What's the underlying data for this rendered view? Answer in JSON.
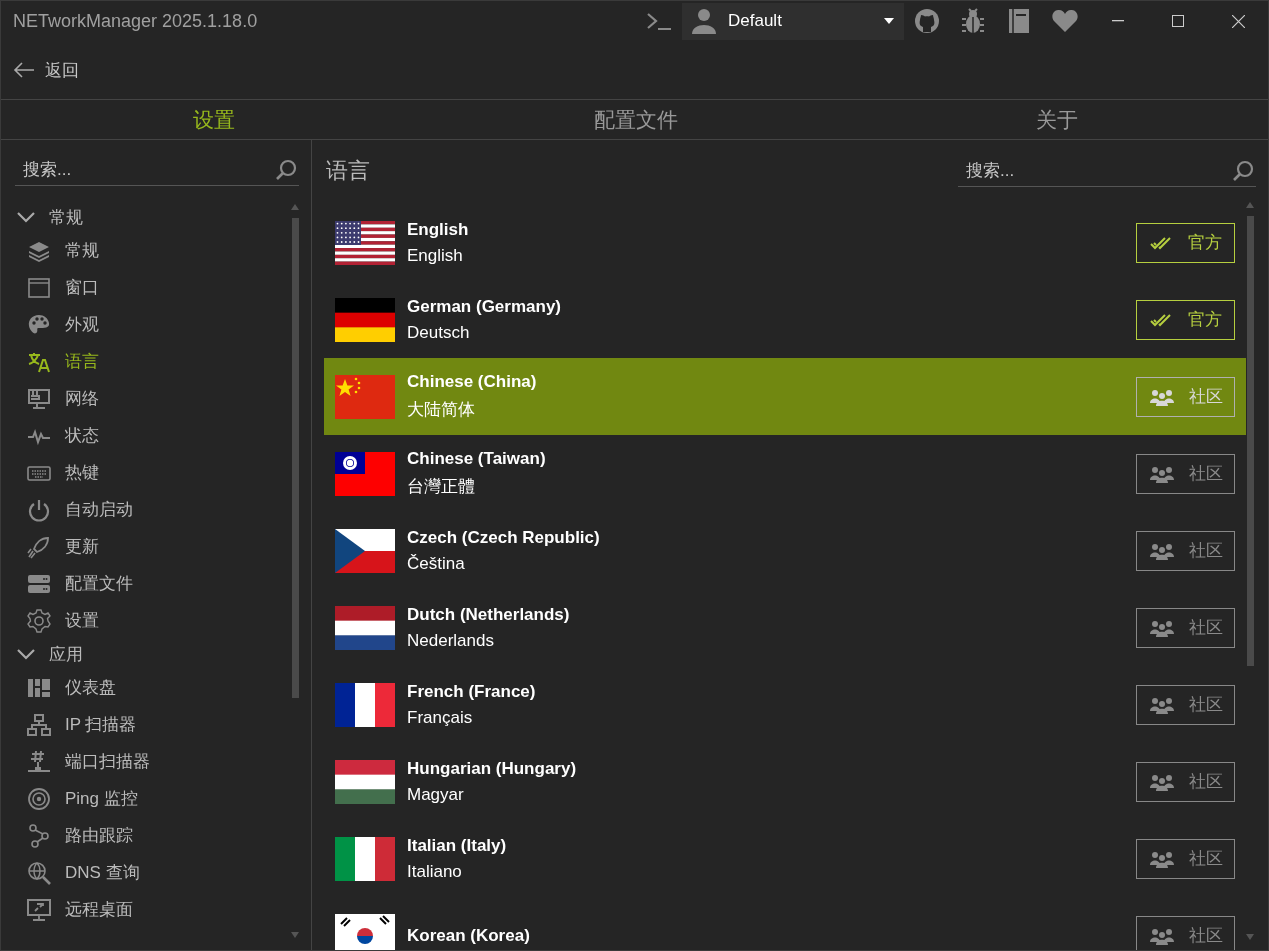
{
  "window": {
    "title": "NETworkManager 2025.1.18.0"
  },
  "profile": {
    "value": "Default"
  },
  "back": {
    "label": "返回"
  },
  "tabs": [
    {
      "label": "设置",
      "selected": true
    },
    {
      "label": "配置文件",
      "selected": false
    },
    {
      "label": "关于",
      "selected": false
    }
  ],
  "sidebar": {
    "search": {
      "placeholder": "搜索..."
    },
    "groups": [
      {
        "label": "常规",
        "expanded": true,
        "children": [
          {
            "label": "常规",
            "selected": false
          },
          {
            "label": "窗口",
            "selected": false
          },
          {
            "label": "外观",
            "selected": false
          },
          {
            "label": "语言",
            "selected": true
          },
          {
            "label": "网络",
            "selected": false
          },
          {
            "label": "状态",
            "selected": false
          },
          {
            "label": "热键",
            "selected": false
          },
          {
            "label": "自动启动",
            "selected": false
          },
          {
            "label": "更新",
            "selected": false
          },
          {
            "label": "配置文件",
            "selected": false
          },
          {
            "label": "设置",
            "selected": false
          }
        ]
      },
      {
        "label": "应用",
        "expanded": true,
        "children": [
          {
            "label": "仪表盘",
            "selected": false
          },
          {
            "label": "IP 扫描器",
            "selected": false
          },
          {
            "label": "端口扫描器",
            "selected": false
          },
          {
            "label": "Ping 监控",
            "selected": false
          },
          {
            "label": "路由跟踪",
            "selected": false
          },
          {
            "label": "DNS 查询",
            "selected": false
          },
          {
            "label": "远程桌面",
            "selected": false
          }
        ]
      }
    ]
  },
  "content": {
    "heading": "语言",
    "search": {
      "placeholder": "搜索..."
    },
    "languages": [
      {
        "kind": "us",
        "name": "English",
        "native": "English",
        "selected": false,
        "badge": {
          "kind": "official",
          "label": "官方"
        }
      },
      {
        "kind": "de",
        "name": "German (Germany)",
        "native": "Deutsch",
        "selected": false,
        "badge": {
          "kind": "official",
          "label": "官方"
        }
      },
      {
        "kind": "cn",
        "name": "Chinese (China)",
        "native": "大陆简体",
        "selected": true,
        "badge": {
          "kind": "community",
          "label": "社区"
        }
      },
      {
        "kind": "tw",
        "name": "Chinese (Taiwan)",
        "native": "台灣正體",
        "selected": false,
        "badge": {
          "kind": "community",
          "label": "社区"
        }
      },
      {
        "kind": "cz",
        "name": "Czech (Czech Republic)",
        "native": "Čeština",
        "selected": false,
        "badge": {
          "kind": "community",
          "label": "社区"
        }
      },
      {
        "kind": "nl",
        "name": "Dutch (Netherlands)",
        "native": "Nederlands",
        "selected": false,
        "badge": {
          "kind": "community",
          "label": "社区"
        }
      },
      {
        "kind": "fr",
        "name": "French (France)",
        "native": "Français",
        "selected": false,
        "badge": {
          "kind": "community",
          "label": "社区"
        }
      },
      {
        "kind": "hu",
        "name": "Hungarian (Hungary)",
        "native": "Magyar",
        "selected": false,
        "badge": {
          "kind": "community",
          "label": "社区"
        }
      },
      {
        "kind": "it",
        "name": "Italian (Italy)",
        "native": "Italiano",
        "selected": false,
        "badge": {
          "kind": "community",
          "label": "社区"
        }
      },
      {
        "kind": "kr",
        "name": "Korean (Korea)",
        "selected": false,
        "badge": {
          "kind": "community",
          "label": "社区"
        }
      }
    ]
  }
}
